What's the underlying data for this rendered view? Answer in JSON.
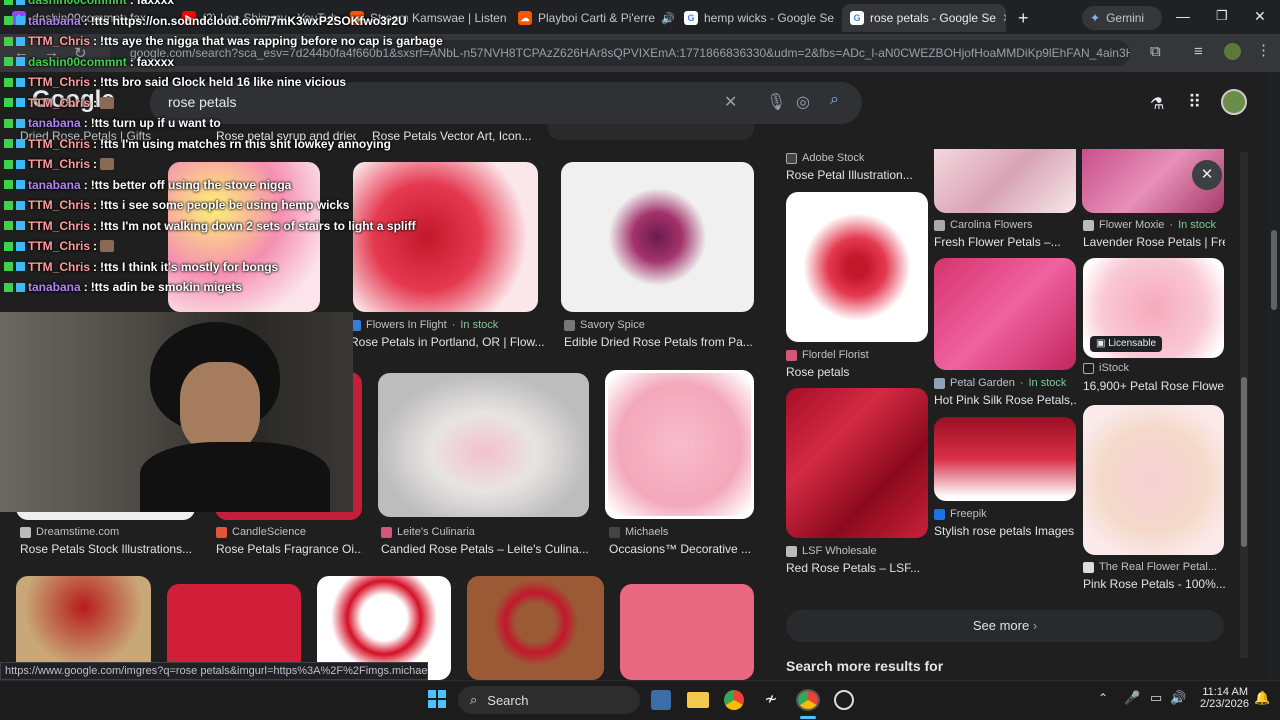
{
  "browser": {
    "tabs": [
      {
        "label": "dashin00commnt: fax"
      },
      {
        "label": "(2) Loe Shimmy - YouTube"
      },
      {
        "label": "Stream Kamswae | Listen"
      },
      {
        "label": "Playboi Carti & Pi'erre"
      },
      {
        "label": "hemp wicks - Google Se"
      },
      {
        "label": "rose petals - Google Se"
      },
      {
        "label": "Gemini"
      }
    ],
    "url": "google.com/search?sca_esv=7d244b0fa4f660b1&sxsrf=ANbL-n57NVH8TCPAzZ626HAr8sQPVIXEmA:1771866836330&udm=2&fbs=ADc_l-aN0CWEZBOHjofHoaMMDiKp9lEhFAN_4ain3HS..."
  },
  "google": {
    "logo": "Google",
    "query": "rose petals"
  },
  "left_results": {
    "row0": [
      "Dried Rose Petals | Gifts",
      "Rose petal syrup and dried...",
      "Rose Petals Vector Art, Icon..."
    ],
    "row1": [
      {
        "source": "Flowers In Flight",
        "stock": "In stock",
        "title": "Rose Petals in Portland, OR | Flow..."
      },
      {
        "source": "Savory Spice",
        "title": "Edible Dried Rose Petals from Pa..."
      }
    ],
    "row2": [
      {
        "source": "Dreamstime.com",
        "title": "Rose Petals Stock Illustrations..."
      },
      {
        "source": "CandleScience",
        "title": "Rose Petals Fragrance Oi..."
      },
      {
        "source": "Leite's Culinaria",
        "title": "Candied Rose Petals – Leite's Culina..."
      },
      {
        "source": "Michaels",
        "title": "Occasions™ Decorative ..."
      }
    ]
  },
  "right_panel": {
    "top_source": "Adobe Stock",
    "top_title": "Rose Petal Illustration...",
    "items": [
      {
        "source": "Carolina Flowers",
        "title": "Fresh Flower Petals –..."
      },
      {
        "source": "Flower Moxie",
        "stock": "In stock",
        "title": "Lavender Rose Petals | Fres..."
      },
      {
        "source": "Flordel Florist",
        "title": "Rose petals"
      },
      {
        "source": "Petal Garden",
        "stock": "In stock",
        "title": "Hot Pink Silk Rose Petals,..."
      },
      {
        "source": "iStock",
        "title": "16,900+ Petal Rose Flower..."
      },
      {
        "source": "Freepik",
        "title": "Stylish rose petals Images ..."
      },
      {
        "source": "LSF Wholesale",
        "title": "Red Rose Petals – LSF..."
      },
      {
        "source": "The Real Flower Petal...",
        "title": "Pink Rose Petals - 100%..."
      }
    ],
    "licensable": "Licensable",
    "see_more": "See more",
    "bottom_text": "Search more results for"
  },
  "chat": [
    {
      "user": "dashin00commnt",
      "msg": "faxxxx",
      "color": "#3fd14b"
    },
    {
      "user": "tanabana",
      "msg": "!tts https://on.soundcloud.com/7mK3wxP2SOKfwo3r2U",
      "color": "#b084f5"
    },
    {
      "user": "TTM_Chris",
      "msg": "!tts aye the nigga that was rapping before no cap is garbage",
      "color": "#ff9b9b"
    },
    {
      "user": "dashin00commnt",
      "msg": "faxxxx",
      "color": "#3fd14b"
    },
    {
      "user": "TTM_Chris",
      "msg": "!tts bro said Glock held 16 like nine vicious",
      "color": "#ff9b9b"
    },
    {
      "user": "TTM_Chris",
      "msg": "",
      "color": "#ff9b9b"
    },
    {
      "user": "tanabana",
      "msg": "!tts turn up if u want to",
      "color": "#b084f5"
    },
    {
      "user": "TTM_Chris",
      "msg": "!tts I'm using matches rn this shit lowkey annoying",
      "color": "#ff9b9b"
    },
    {
      "user": "TTM_Chris",
      "msg": "",
      "color": "#ff9b9b"
    },
    {
      "user": "tanabana",
      "msg": "!tts better off using the stove nigga",
      "color": "#b084f5"
    },
    {
      "user": "TTM_Chris",
      "msg": "!tts i see some people be using hemp wicks",
      "color": "#ff9b9b"
    },
    {
      "user": "TTM_Chris",
      "msg": "!tts I'm not walking down 2 sets of stairs to light a spliff",
      "color": "#ff9b9b"
    },
    {
      "user": "TTM_Chris",
      "msg": "",
      "color": "#ff9b9b"
    },
    {
      "user": "TTM_Chris",
      "msg": "!tts I think it's mostly for bongs",
      "color": "#ff9b9b"
    },
    {
      "user": "tanabana",
      "msg": "!tts adin be smokin migets",
      "color": "#b084f5"
    }
  ],
  "status_url": "https://www.google.com/imgres?q=rose petals&imgurl=https%3A%2F%2Fimgs.michaels.co...",
  "taskbar": {
    "search": "Search",
    "time": "11:14 AM",
    "date": "2/23/2026"
  }
}
